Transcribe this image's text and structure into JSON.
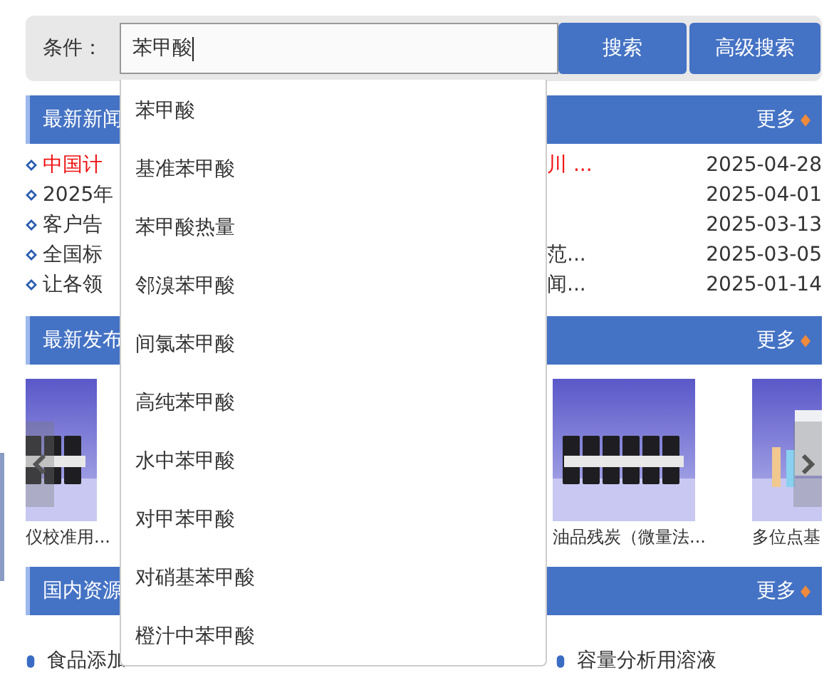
{
  "search": {
    "label": "条件：",
    "value": "苯甲酸",
    "buttons": [
      "搜索",
      "高级搜索"
    ]
  },
  "suggestions": [
    "苯甲酸",
    "基准苯甲酸",
    "苯甲酸热量",
    "邻溴苯甲酸",
    "间氯苯甲酸",
    "高纯苯甲酸",
    "水中苯甲酸",
    "对甲苯甲酸",
    "对硝基苯甲酸",
    "橙汁中苯甲酸"
  ],
  "news": {
    "title": "最新新闻",
    "more": "更多",
    "items": [
      {
        "title_start": "中国计",
        "title_end": "川 ...",
        "date": "2025-04-28",
        "highlight": true
      },
      {
        "title_start": "2025年",
        "date": "2025-04-01",
        "highlight": false
      },
      {
        "title_start": "客户告",
        "date": "2025-03-13",
        "highlight": false
      },
      {
        "title_start": "全国标",
        "title_end": "范...",
        "date": "2025-03-05",
        "highlight": false
      },
      {
        "title_start": "让各领",
        "title_end": "闻...",
        "date": "2025-01-14",
        "highlight": false
      }
    ]
  },
  "products": {
    "title": "最新发布",
    "more": "更多",
    "items": [
      {
        "caption": "仪校准用...",
        "kind": "picture"
      },
      {
        "caption": "油品残炭（微量法...",
        "kind": "picture"
      },
      {
        "caption": "多位点基",
        "kind": "picture"
      }
    ]
  },
  "resources": {
    "title": "国内资源",
    "more": "更多",
    "items": [
      "食品添加",
      "容量分析用溶液"
    ]
  }
}
